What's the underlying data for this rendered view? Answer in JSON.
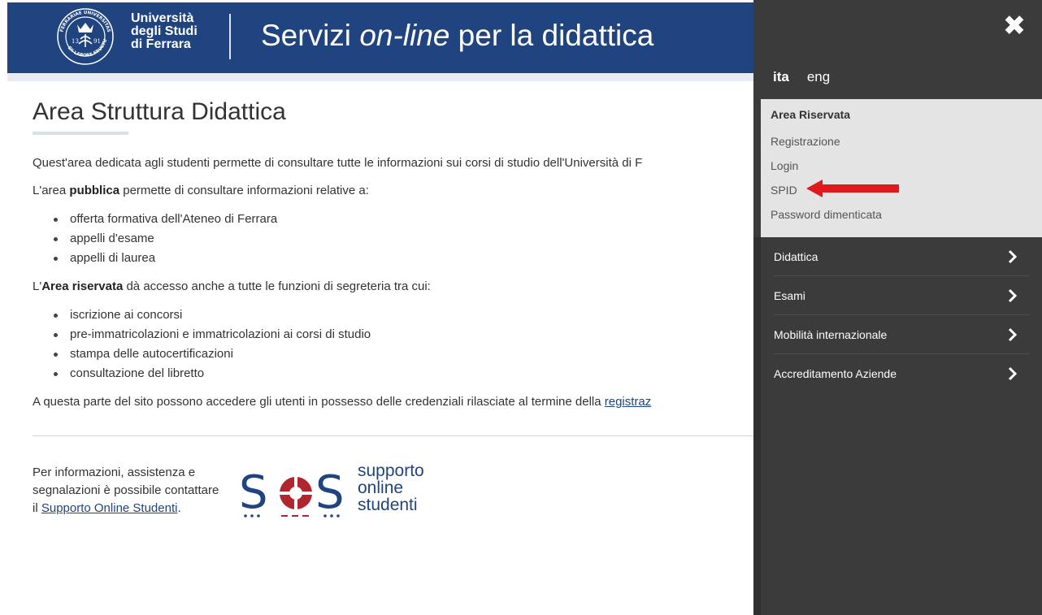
{
  "header": {
    "logo_lines": [
      "Università",
      "degli Studi",
      "di Ferrara"
    ],
    "seal_text": [
      "FERRARIAE UNIVERSITAS",
      "EX LABORE FRUCTUS",
      "13",
      "91"
    ],
    "title_prefix": "Servizi ",
    "title_italic": "on-line",
    "title_suffix": " per la didattica"
  },
  "main": {
    "page_title": "Area Struttura Didattica",
    "intro": "Quest'area dedicata agli studenti permette di consultare tutte le informazioni sui corsi di studio dell'Università di F",
    "public_pre": "L'area ",
    "public_bold": "pubblica",
    "public_post": " permette di consultare informazioni relative a:",
    "public_items": [
      "offerta formativa dell'Ateneo di Ferrara",
      "appelli d'esame",
      "appelli di laurea"
    ],
    "reserved_pre": "L'",
    "reserved_bold": "Area riservata",
    "reserved_post": " dà accesso anche a tutte le funzioni di segreteria tra cui:",
    "reserved_items": [
      "iscrizione ai concorsi",
      "pre-immatricolazioni e immatricolazioni ai corsi di studio",
      "stampa delle autocertificazioni",
      "consultazione del libretto"
    ],
    "access_text": "A questa parte del sito possono accedere gli utenti in possesso delle credenziali rilasciate al termine della ",
    "access_link": "registraz",
    "footer_pre": "Per informazioni, assistenza e segnalazioni è possibile contattare il ",
    "footer_link": "Supporto Online Studenti",
    "footer_post": ".",
    "sos_words": [
      "supporto",
      "online",
      "studenti"
    ]
  },
  "panel": {
    "close_label": "✖",
    "lang_active": "ita",
    "lang_other": "eng",
    "reserved_title": "Area Riservata",
    "reserved_links": [
      "Registrazione",
      "Login",
      "SPID",
      "Password dimenticata"
    ],
    "menu": [
      "Didattica",
      "Esami",
      "Mobilità internazionale",
      "Accreditamento Aziende"
    ]
  },
  "colors": {
    "header_blue": "#1f4480",
    "panel_dark": "#3b3b3b",
    "reserved_bg": "#e4e4e4",
    "arrow_red": "#e0191c",
    "sos_red": "#b0262c"
  }
}
